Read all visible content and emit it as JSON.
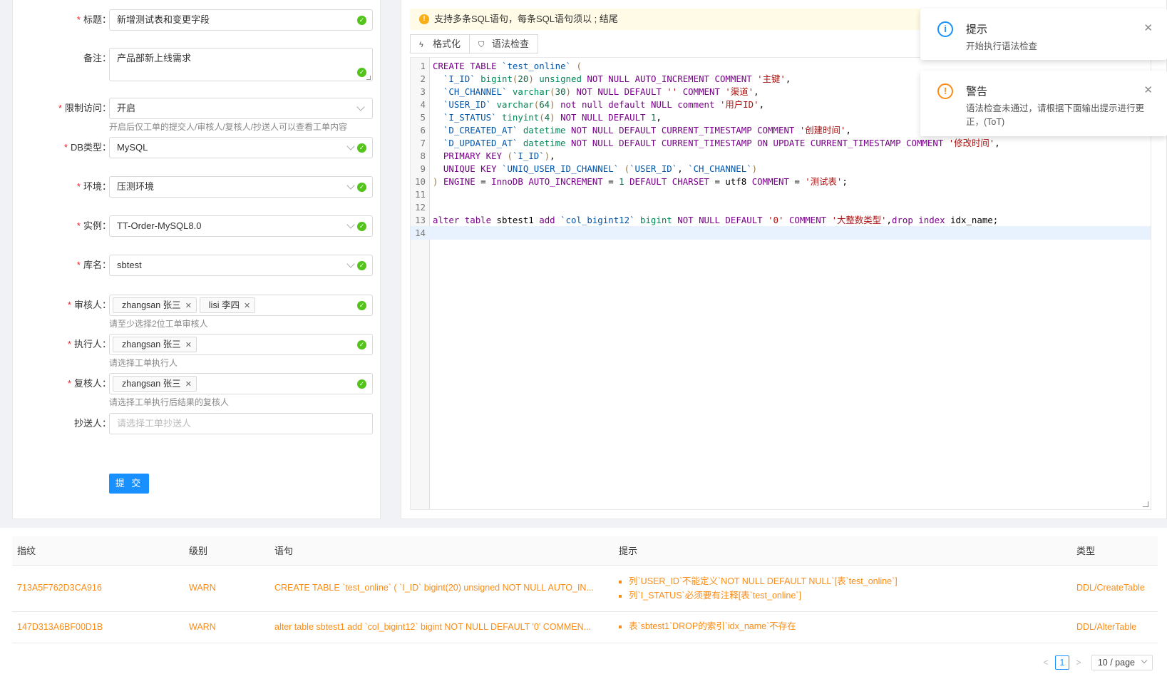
{
  "form": {
    "title": {
      "label": "标题：",
      "value": "新增测试表和变更字段"
    },
    "remark": {
      "label": "备注：",
      "value": "产品部新上线需求"
    },
    "restrict": {
      "label": "限制访问：",
      "value": "开启",
      "help": "开启后仅工单的提交人/审核人/复核人/抄送人可以查看工单内容"
    },
    "db_type": {
      "label": "DB类型：",
      "value": "MySQL"
    },
    "env": {
      "label": "环境：",
      "value": "压测环境"
    },
    "instance": {
      "label": "实例：",
      "value": "TT-Order-MySQL8.0"
    },
    "database": {
      "label": "库名：",
      "value": "sbtest"
    },
    "reviewers": {
      "label": "审核人：",
      "tags": [
        "zhangsan 张三",
        "lisi 李四"
      ],
      "help": "请至少选择2位工单审核人"
    },
    "executor": {
      "label": "执行人：",
      "tags": [
        "zhangsan 张三"
      ],
      "help": "请选择工单执行人"
    },
    "rechecker": {
      "label": "复核人：",
      "tags": [
        "zhangsan 张三"
      ],
      "help": "请选择工单执行后结果的复核人"
    },
    "cc": {
      "label": "抄送人：",
      "placeholder": "请选择工单抄送人"
    },
    "submit_label": "提 交"
  },
  "editor": {
    "notice": "支持多条SQL语句，每条SQL语句须以 ; 结尾",
    "format_label": "格式化",
    "check_label": "语法检查",
    "line_numbers": [
      "1",
      "2",
      "3",
      "4",
      "5",
      "6",
      "7",
      "8",
      "9",
      "10",
      "11",
      "12",
      "13",
      "14"
    ]
  },
  "toasts": [
    {
      "title": "提示",
      "body": "开始执行语法检查",
      "type": "info"
    },
    {
      "title": "警告",
      "body": "语法检查未通过，请根据下面输出提示进行更正，(ToT)",
      "type": "warning"
    }
  ],
  "results": {
    "columns": [
      "指纹",
      "级别",
      "语句",
      "提示",
      "类型"
    ],
    "rows": [
      {
        "fingerprint": "713A5F762D3CA916",
        "level": "WARN",
        "statement": "CREATE TABLE `test_online` ( `I_ID` bigint(20) unsigned NOT NULL AUTO_IN...",
        "hints": [
          "列`USER_ID`不能定义`NOT NULL DEFAULT NULL`[表`test_online`]",
          "列`I_STATUS`必须要有注释[表`test_online`]"
        ],
        "type": "DDL/CreateTable"
      },
      {
        "fingerprint": "147D313A6BF00D1B",
        "level": "WARN",
        "statement": "alter table sbtest1 add `col_bigint12` bigint NOT NULL DEFAULT '0' COMMEN...",
        "hints": [
          "表`sbtest1`DROP的索引`idx_name`不存在"
        ],
        "type": "DDL/AlterTable"
      }
    ],
    "pager": {
      "prev": "<",
      "page": "1",
      "next": ">",
      "size": "10 / page"
    }
  },
  "colors": {
    "accent": "#1890ff",
    "warn": "#fa8c16",
    "success": "#52c41a",
    "required": "#f5222d"
  }
}
